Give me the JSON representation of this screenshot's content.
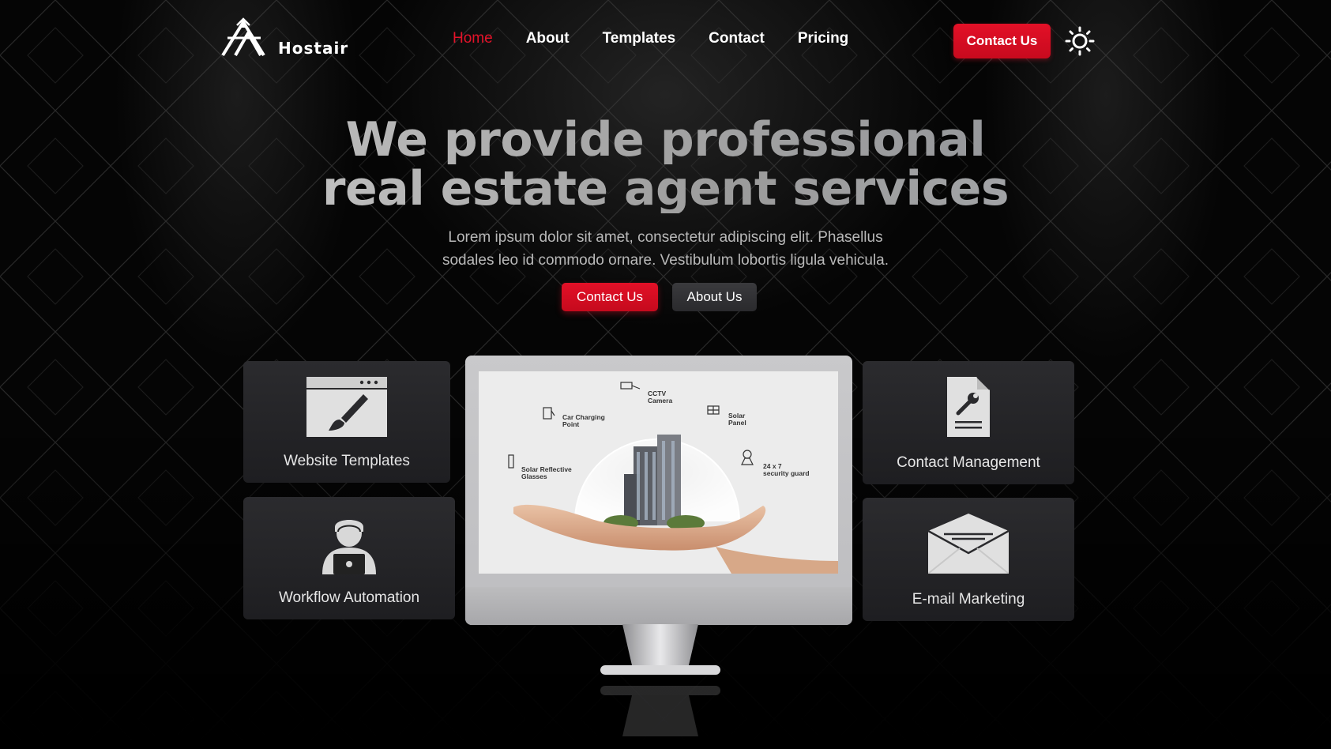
{
  "brand": {
    "name": "Hostair"
  },
  "nav": {
    "items": [
      "Home",
      "About",
      "Templates",
      "Contact",
      "Pricing"
    ],
    "active": "Home"
  },
  "header": {
    "cta_label": "Contact Us"
  },
  "hero": {
    "title_line1": "We provide professional",
    "title_line2": "real estate agent services",
    "subtitle_line1": "Lorem ipsum dolor sit amet, consectetur adipiscing elit. Phasellus",
    "subtitle_line2": "sodales leo id commodo ornare. Vestibulum lobortis ligula vehicula.",
    "primary_btn": "Contact Us",
    "secondary_btn": "About Us"
  },
  "features": [
    {
      "label": "Website Templates",
      "icon": "website-template-icon"
    },
    {
      "label": "Workflow Automation",
      "icon": "developer-icon"
    },
    {
      "label": "Contact Management",
      "icon": "document-wrench-icon"
    },
    {
      "label": "E-mail Marketing",
      "icon": "envelope-icon"
    }
  ],
  "screen": {
    "labels": {
      "cctv": [
        "CCTV",
        "Camera"
      ],
      "charging": [
        "Car Charging",
        "Point"
      ],
      "solar": [
        "Solar",
        "Panel"
      ],
      "glass": [
        "Solar Reflective",
        "Glasses"
      ],
      "security": [
        "24 x 7",
        "security guard"
      ]
    }
  },
  "colors": {
    "accent": "#e4132a",
    "background": "#000000",
    "card": "#26262a"
  }
}
